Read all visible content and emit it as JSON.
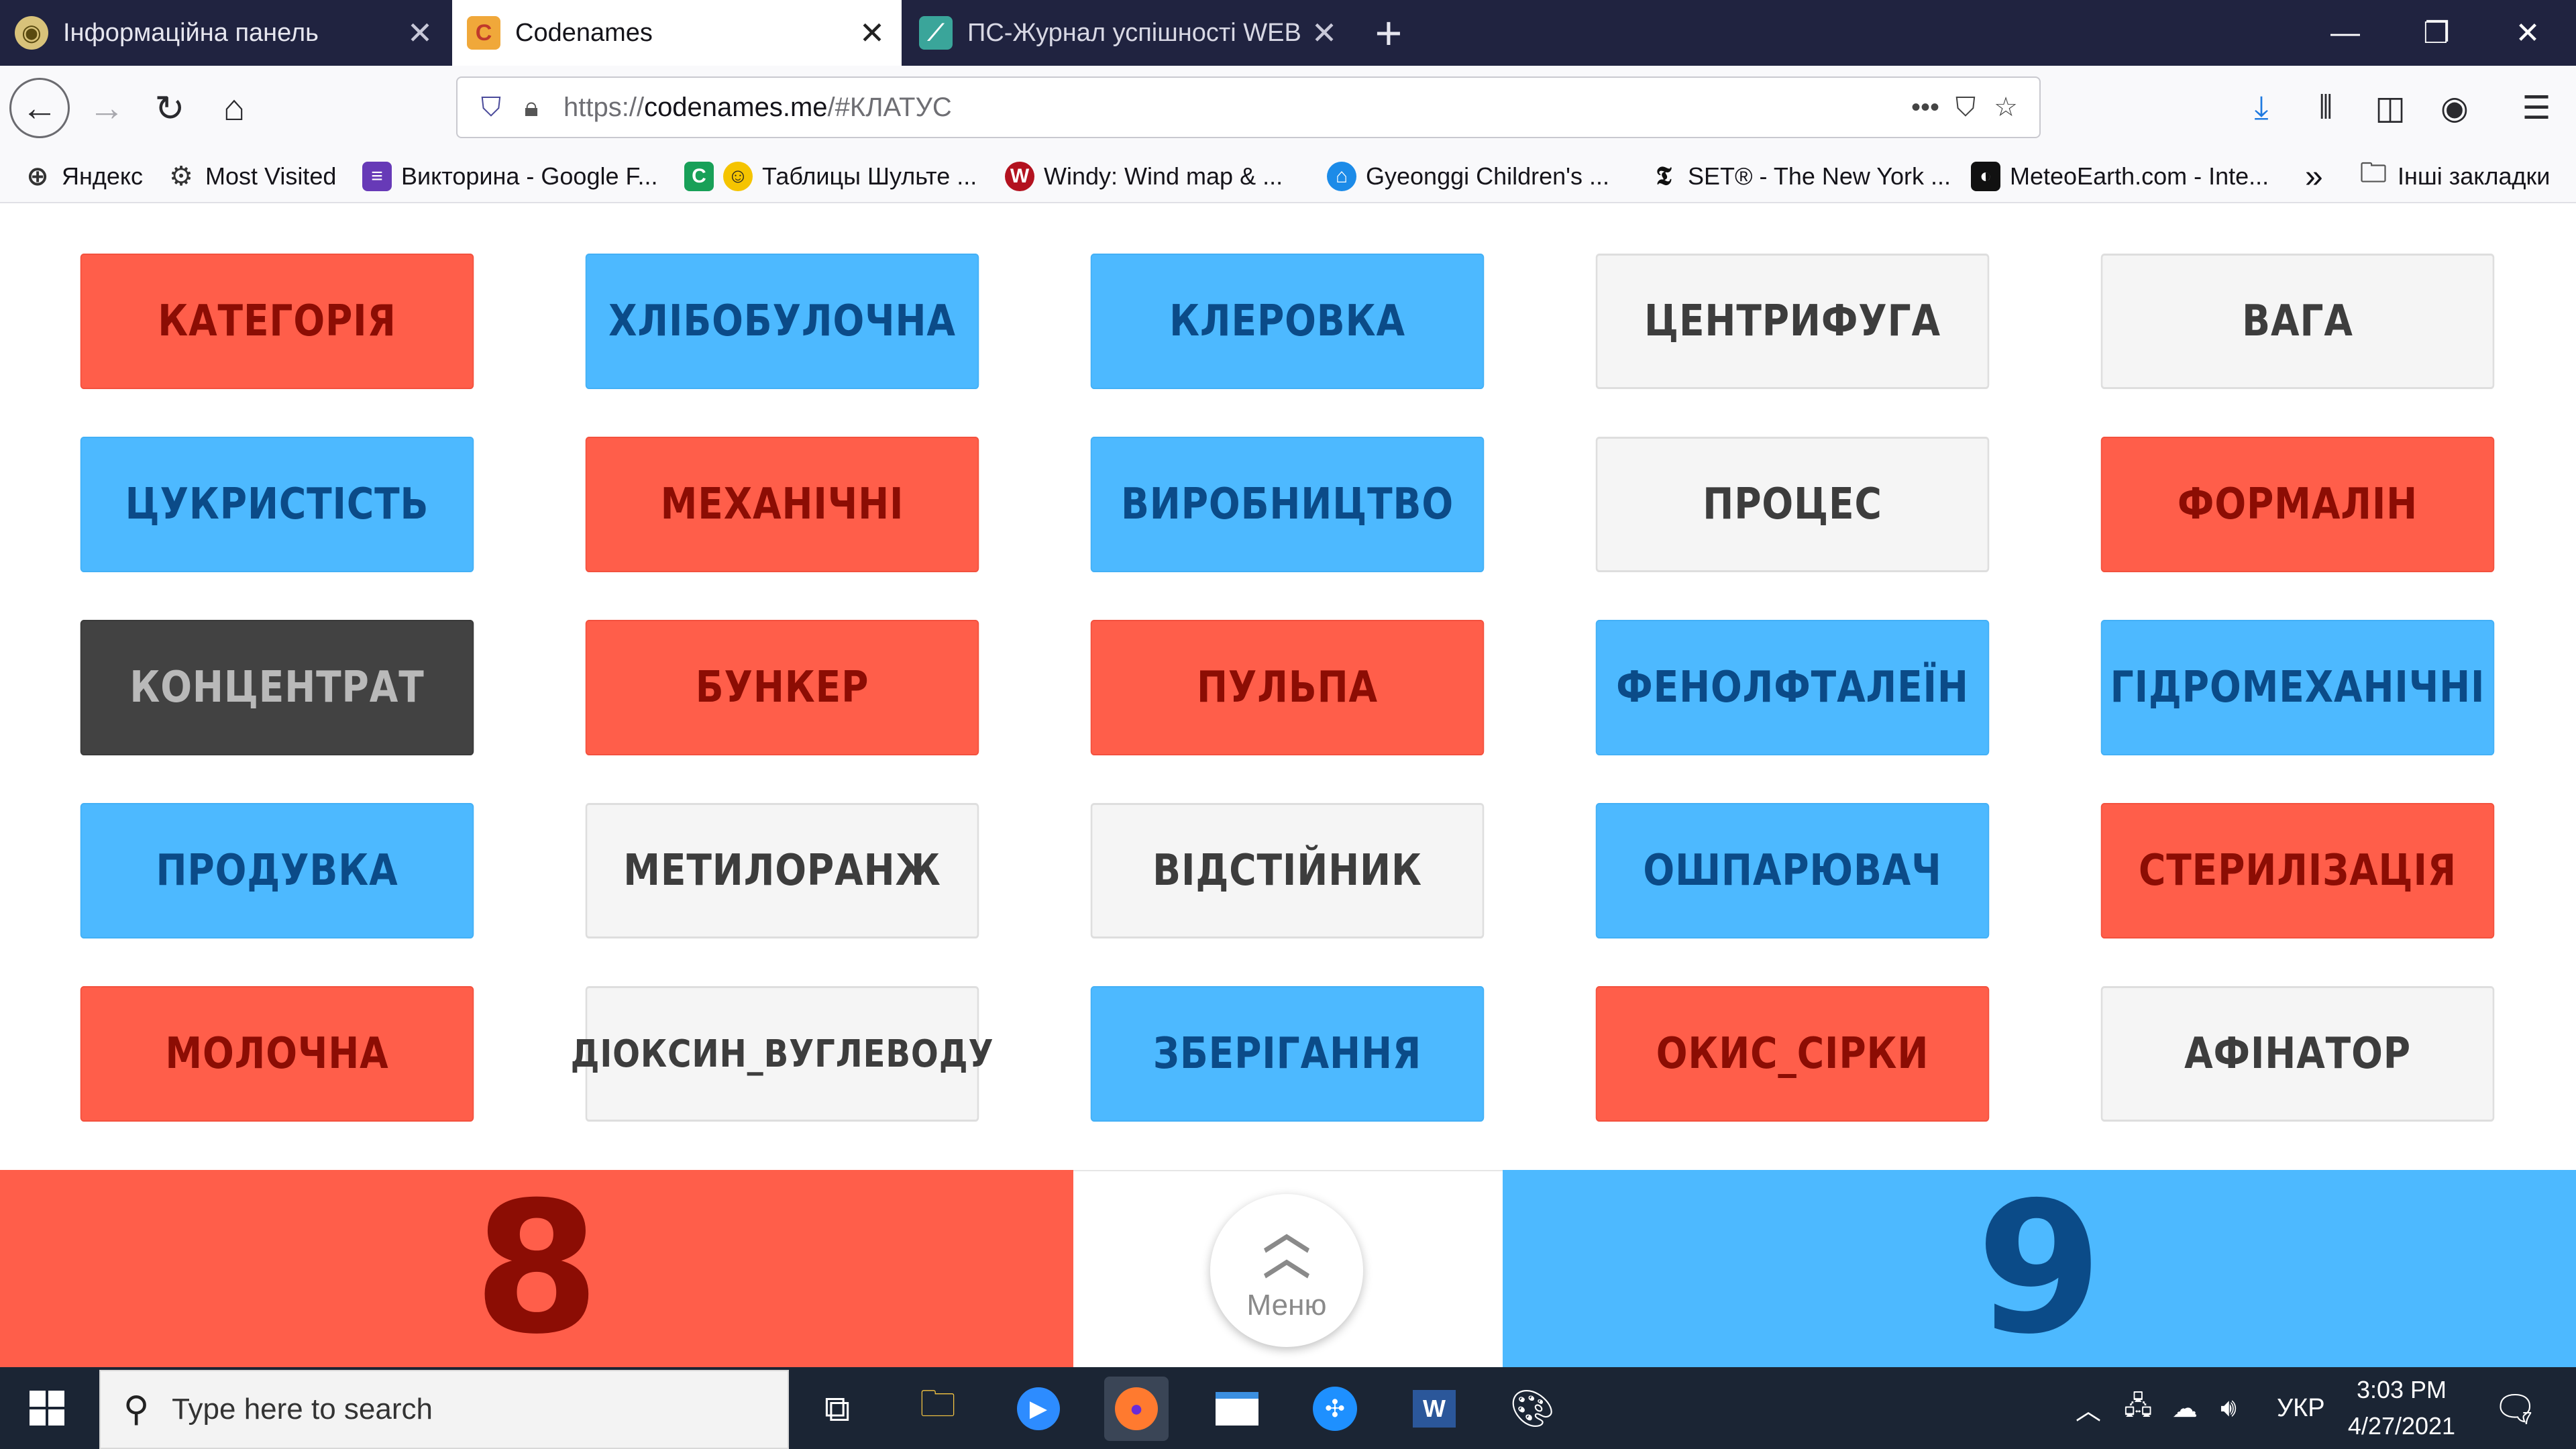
{
  "browser": {
    "tabs": [
      {
        "title": "Інформаційна панель",
        "favicon": "owl-icon",
        "active": false
      },
      {
        "title": "Codenames",
        "favicon": "codenames-icon",
        "active": true
      },
      {
        "title": "ПС-Журнал успішності WEB v",
        "favicon": "chart-icon",
        "active": false
      }
    ],
    "url": {
      "prefix": "https://",
      "host": "codenames.me",
      "path": "/#КЛАТУС"
    },
    "bookmarks": [
      {
        "label": "Яндекс",
        "icon": "globe-icon"
      },
      {
        "label": "Most Visited",
        "icon": "gear-icon"
      },
      {
        "label": "Викторина - Google F...",
        "icon": "forms-icon"
      },
      {
        "label": "Таблицы Шульте ...",
        "icon": "smiley-icon"
      },
      {
        "label": "Windy: Wind map & ...",
        "icon": "windy-icon"
      },
      {
        "label": "Gyeonggi Children's ...",
        "icon": "museum-icon"
      },
      {
        "label": "SET® - The New York ...",
        "icon": "nyt-icon"
      },
      {
        "label": "MeteoEarth.com - Inte...",
        "icon": "meteoearth-icon"
      }
    ],
    "other_bookmarks": "Інші закладки"
  },
  "board": {
    "cards": [
      {
        "word": "КАТЕГОРІЯ",
        "team": "red"
      },
      {
        "word": "ХЛІБОБУЛОЧНА",
        "team": "blue"
      },
      {
        "word": "КЛЕРОВКА",
        "team": "blue"
      },
      {
        "word": "ЦЕНТРИФУГА",
        "team": "neutral"
      },
      {
        "word": "ВАГА",
        "team": "neutral"
      },
      {
        "word": "ЦУКРИСТІСТЬ",
        "team": "blue"
      },
      {
        "word": "МЕХАНІЧНІ",
        "team": "red"
      },
      {
        "word": "ВИРОБНИЦТВО",
        "team": "blue"
      },
      {
        "word": "ПРОЦЕС",
        "team": "neutral"
      },
      {
        "word": "ФОРМАЛІН",
        "team": "red"
      },
      {
        "word": "КОНЦЕНТРАТ",
        "team": "assassin"
      },
      {
        "word": "БУНКЕР",
        "team": "red"
      },
      {
        "word": "ПУЛЬПА",
        "team": "red"
      },
      {
        "word": "ФЕНОЛФТАЛЕЇН",
        "team": "blue"
      },
      {
        "word": "ГІДРОМЕХАНІЧНІ",
        "team": "blue"
      },
      {
        "word": "ПРОДУВКА",
        "team": "blue"
      },
      {
        "word": "МЕТИЛОРАНЖ",
        "team": "neutral"
      },
      {
        "word": "ВІДСТІЙНИК",
        "team": "neutral"
      },
      {
        "word": "ОШПАРЮВАЧ",
        "team": "blue"
      },
      {
        "word": "СТЕРИЛІЗАЦІЯ",
        "team": "red"
      },
      {
        "word": "МОЛОЧНА",
        "team": "red"
      },
      {
        "word": "ДІОКСИН_ВУГЛЕВОДУ",
        "team": "neutral"
      },
      {
        "word": "ЗБЕРІГАННЯ",
        "team": "blue"
      },
      {
        "word": "ОКИС_СІРКИ",
        "team": "red"
      },
      {
        "word": "АФІНАТОР",
        "team": "neutral"
      }
    ],
    "score": {
      "red": "8",
      "blue": "9"
    },
    "menu_label": "Меню",
    "colors": {
      "red": "#ff5e4a",
      "blue": "#4db9ff",
      "neutral": "#f5f5f5",
      "assassin": "#424242"
    }
  },
  "taskbar": {
    "search_placeholder": "Type here to search",
    "apps": [
      "task-view-icon",
      "file-explorer-icon",
      "zoom-icon",
      "firefox-icon",
      "app-window-icon",
      "network-app-icon",
      "word-icon",
      "paint-icon"
    ],
    "language": "УКР",
    "time": "3:03 PM",
    "date": "4/27/2021",
    "notifications": "7"
  }
}
